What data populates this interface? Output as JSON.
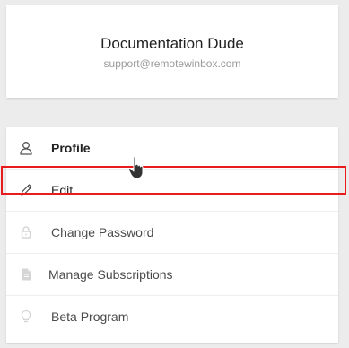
{
  "profile": {
    "name": "Documentation Dude",
    "email": "support@remotewinbox.com"
  },
  "menu": {
    "items": [
      {
        "label": "Profile",
        "icon": "user-icon"
      },
      {
        "label": "Edit",
        "icon": "pencil-icon"
      },
      {
        "label": "Change Password",
        "icon": "lock-icon"
      },
      {
        "label": "Manage Subscriptions",
        "icon": "document-icon"
      },
      {
        "label": "Beta Program",
        "icon": "lightbulb-icon"
      }
    ]
  },
  "colors": {
    "background": "#ececec",
    "card": "#ffffff",
    "highlight": "#e81c1c",
    "muted_icon": "#d5d5d5",
    "text": "#4a4a4a"
  }
}
